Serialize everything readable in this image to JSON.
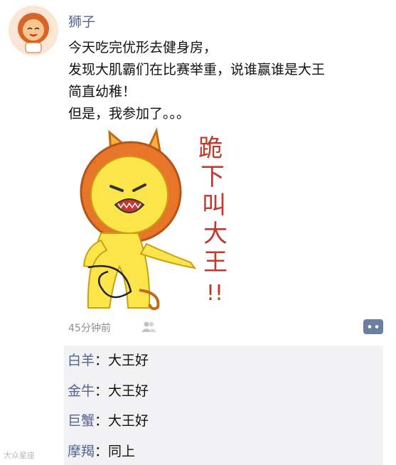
{
  "post": {
    "username": "狮子",
    "lines": [
      "今天吃完优形去健身房，",
      "发现大肌霸们在比赛举重，说谁赢谁是大王",
      "简直幼稚！",
      "但是，我参加了。。。"
    ],
    "sticker_text": [
      "跪",
      "下",
      "叫",
      "大",
      "王",
      "!!"
    ],
    "timestamp": "45分钟前"
  },
  "comments": [
    {
      "name": "白羊",
      "separator": "：",
      "text": "大王好"
    },
    {
      "name": "金牛",
      "separator": "：",
      "text": "大王好"
    },
    {
      "name": "巨蟹",
      "separator": "：",
      "text": "大王好"
    },
    {
      "name": "摩羯",
      "separator": "：",
      "text": "同上"
    }
  ],
  "watermark": "大众星座",
  "colors": {
    "name_link": "#55648f",
    "comment_bg": "#f2f2f4",
    "lion_mane": "#e8762a",
    "lion_face": "#fbe54a"
  },
  "icons": [
    "lion-avatar",
    "friends-icon",
    "comment-icon"
  ]
}
